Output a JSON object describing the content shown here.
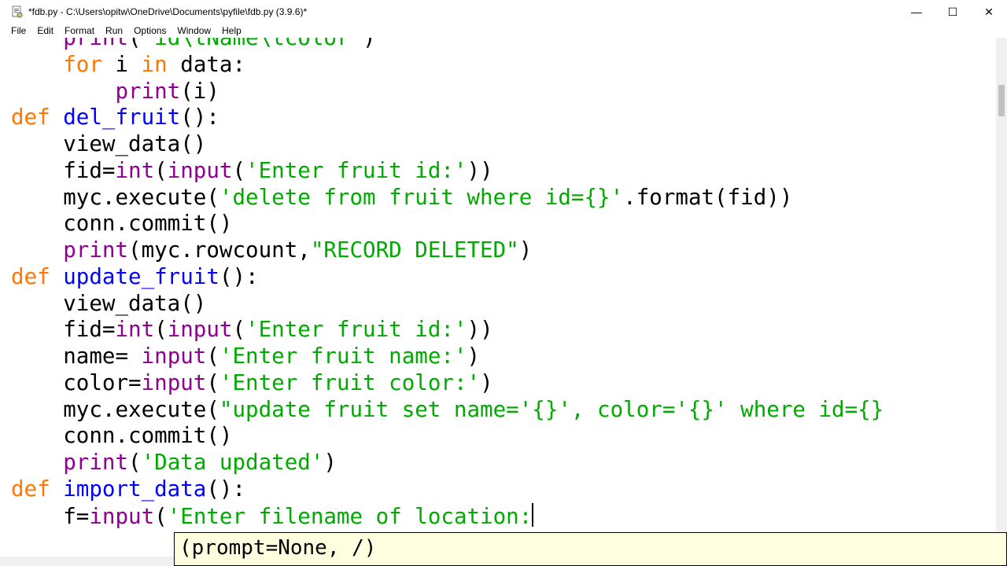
{
  "window": {
    "title": "*fdb.py - C:\\Users\\opitw\\OneDrive\\Documents\\pyfile\\fdb.py (3.9.6)*",
    "controls": {
      "minimize": "—",
      "maximize": "☐",
      "close": "✕"
    }
  },
  "menu": [
    "File",
    "Edit",
    "Format",
    "Run",
    "Options",
    "Window",
    "Help"
  ],
  "editor": {
    "lines": [
      [
        {
          "t": "    "
        },
        {
          "t": "print",
          "c": "bi"
        },
        {
          "t": "("
        },
        {
          "t": "'id\\tName\\tcolor'",
          "c": "st"
        },
        {
          "t": ")"
        }
      ],
      [
        {
          "t": "    "
        },
        {
          "t": "for",
          "c": "kw"
        },
        {
          "t": " i "
        },
        {
          "t": "in",
          "c": "kw"
        },
        {
          "t": " data:"
        }
      ],
      [
        {
          "t": "        "
        },
        {
          "t": "print",
          "c": "bi"
        },
        {
          "t": "(i)"
        }
      ],
      [
        {
          "t": "def",
          "c": "kw"
        },
        {
          "t": " "
        },
        {
          "t": "del_fruit",
          "c": "df"
        },
        {
          "t": "():"
        }
      ],
      [
        {
          "t": "    view_data()"
        }
      ],
      [
        {
          "t": "    fid="
        },
        {
          "t": "int",
          "c": "bi"
        },
        {
          "t": "("
        },
        {
          "t": "input",
          "c": "bi"
        },
        {
          "t": "("
        },
        {
          "t": "'Enter fruit id:'",
          "c": "st"
        },
        {
          "t": "))"
        }
      ],
      [
        {
          "t": "    myc.execute("
        },
        {
          "t": "'delete from fruit where id={}'",
          "c": "st"
        },
        {
          "t": ".format(fid))"
        }
      ],
      [
        {
          "t": "    conn.commit()"
        }
      ],
      [
        {
          "t": "    "
        },
        {
          "t": "print",
          "c": "bi"
        },
        {
          "t": "(myc.rowcount,"
        },
        {
          "t": "\"RECORD DELETED\"",
          "c": "st"
        },
        {
          "t": ")"
        }
      ],
      [
        {
          "t": "def",
          "c": "kw"
        },
        {
          "t": " "
        },
        {
          "t": "update_fruit",
          "c": "df"
        },
        {
          "t": "():"
        }
      ],
      [
        {
          "t": "    view_data()"
        }
      ],
      [
        {
          "t": "    fid="
        },
        {
          "t": "int",
          "c": "bi"
        },
        {
          "t": "("
        },
        {
          "t": "input",
          "c": "bi"
        },
        {
          "t": "("
        },
        {
          "t": "'Enter fruit id:'",
          "c": "st"
        },
        {
          "t": "))"
        }
      ],
      [
        {
          "t": "    name= "
        },
        {
          "t": "input",
          "c": "bi"
        },
        {
          "t": "("
        },
        {
          "t": "'Enter fruit name:'",
          "c": "st"
        },
        {
          "t": ")"
        }
      ],
      [
        {
          "t": "    color="
        },
        {
          "t": "input",
          "c": "bi"
        },
        {
          "t": "("
        },
        {
          "t": "'Enter fruit color:'",
          "c": "st"
        },
        {
          "t": ")"
        }
      ],
      [
        {
          "t": "    myc.execute("
        },
        {
          "t": "\"update fruit set name='{}', color='{}' where id={}",
          "c": "st"
        }
      ],
      [
        {
          "t": "    conn.commit()"
        }
      ],
      [
        {
          "t": "    "
        },
        {
          "t": "print",
          "c": "bi"
        },
        {
          "t": "("
        },
        {
          "t": "'Data updated'",
          "c": "st"
        },
        {
          "t": ")"
        }
      ],
      [
        {
          "t": "def",
          "c": "kw"
        },
        {
          "t": " "
        },
        {
          "t": "import_data",
          "c": "df"
        },
        {
          "t": "():"
        }
      ],
      [
        {
          "t": "    f="
        },
        {
          "t": "input",
          "c": "bi"
        },
        {
          "t": "("
        },
        {
          "t": "'Enter filename of location:",
          "c": "st"
        },
        {
          "t": "",
          "cursor": true
        }
      ]
    ]
  },
  "calltip": {
    "text": "(prompt=None, /)"
  },
  "colors": {
    "keyword": "#ff7700",
    "builtin": "#900090",
    "string": "#00aa00",
    "definition": "#0000ff",
    "calltip_bg": "#ffffe0"
  },
  "icons": {
    "app": "idle-file-icon"
  }
}
